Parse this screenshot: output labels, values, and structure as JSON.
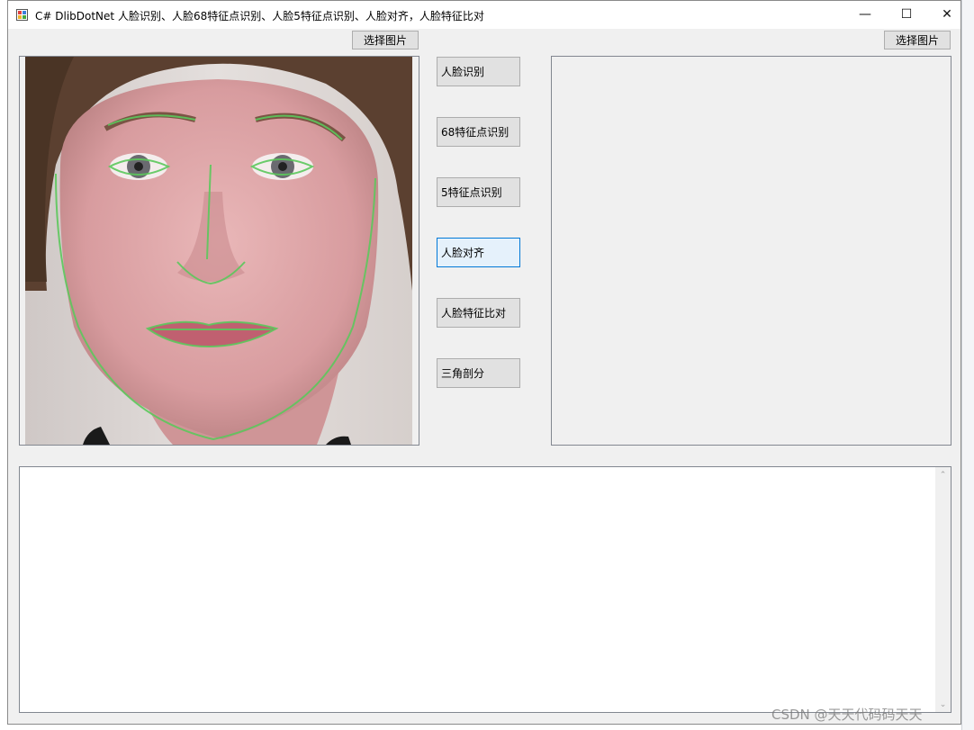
{
  "window": {
    "title": "C# DlibDotNet 人脸识别、人脸68特征点识别、人脸5特征点识别、人脸对齐，人脸特征比对",
    "minimize_glyph": "—",
    "maximize_glyph": "☐",
    "close_glyph": "✕"
  },
  "buttons": {
    "select_image_left": "选择图片",
    "select_image_right": "选择图片",
    "face_detect": "人脸识别",
    "landmarks68": "68特征点识别",
    "landmarks5": "5特征点识别",
    "face_align": "人脸对齐",
    "face_compare": "人脸特征比对",
    "triangulation": "三角剖分"
  },
  "output_text": "",
  "scrollbar": {
    "up": "⌃",
    "down": "⌄"
  },
  "watermark": "CSDN @天天代码码天天",
  "colors": {
    "accent": "#0078d7",
    "landmark_line": "#5cc85c"
  },
  "icons": {
    "app": "app-icon",
    "minimize": "minimize-icon",
    "maximize": "maximize-icon",
    "close": "close-icon"
  }
}
